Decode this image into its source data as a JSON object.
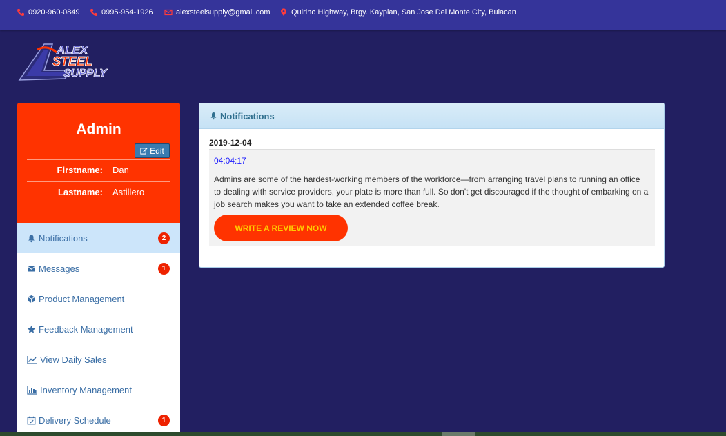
{
  "topbar": {
    "phone1": "0920-960-0849",
    "phone2": "0995-954-1926",
    "email": "alexsteelsupply@gmail.com",
    "address": "Quirino Highway, Brgy. Kaypian, San Jose Del Monte City, Bulacan",
    "icons": [
      "phone-icon",
      "phone-icon",
      "envelope-icon",
      "map-marker-icon"
    ],
    "icon_color": "#ff3b3b"
  },
  "logo": {
    "line1": "ALEX",
    "line2": "STEEL",
    "line3": "SUPPLY"
  },
  "profile": {
    "title": "Admin",
    "edit_label": "Edit",
    "firstname_label": "Firstname:",
    "firstname_value": "Dan",
    "lastname_label": "Lastname:",
    "lastname_value": "Astillero"
  },
  "menu": {
    "items": [
      {
        "label": "Notifications",
        "icon": "bell-icon",
        "badge": "2",
        "active": true
      },
      {
        "label": "Messages",
        "icon": "envelope-icon",
        "badge": "1"
      },
      {
        "label": "Product Management",
        "icon": "cube-icon",
        "badge": ""
      },
      {
        "label": "Feedback Management",
        "icon": "star-icon",
        "badge": ""
      },
      {
        "label": "View Daily Sales",
        "icon": "line-chart-icon",
        "badge": ""
      },
      {
        "label": "Inventory Management",
        "icon": "bar-chart-icon",
        "badge": ""
      },
      {
        "label": "Delivery Schedule",
        "icon": "calendar-check-icon",
        "badge": "1"
      }
    ]
  },
  "notifications": {
    "title": "Notifications",
    "date": "2019-12-04",
    "time": "04:04:17",
    "message": "Admins are some of the hardest-working members of the workforce—from arranging travel plans to running an office to dealing with service providers, your plate is more than full. So don't get discouraged if the thought of embarking on a job search makes you want to take an extended coffee break.",
    "button_label": "WRITE A REVIEW NOW"
  },
  "colors": {
    "page_bg": "#221f61",
    "topbar_bg": "#35349a",
    "profile_bg": "#ff3300",
    "badge_bg": "#ee2200",
    "button_text": "#ffcc00",
    "link": "#3a6ea5"
  }
}
